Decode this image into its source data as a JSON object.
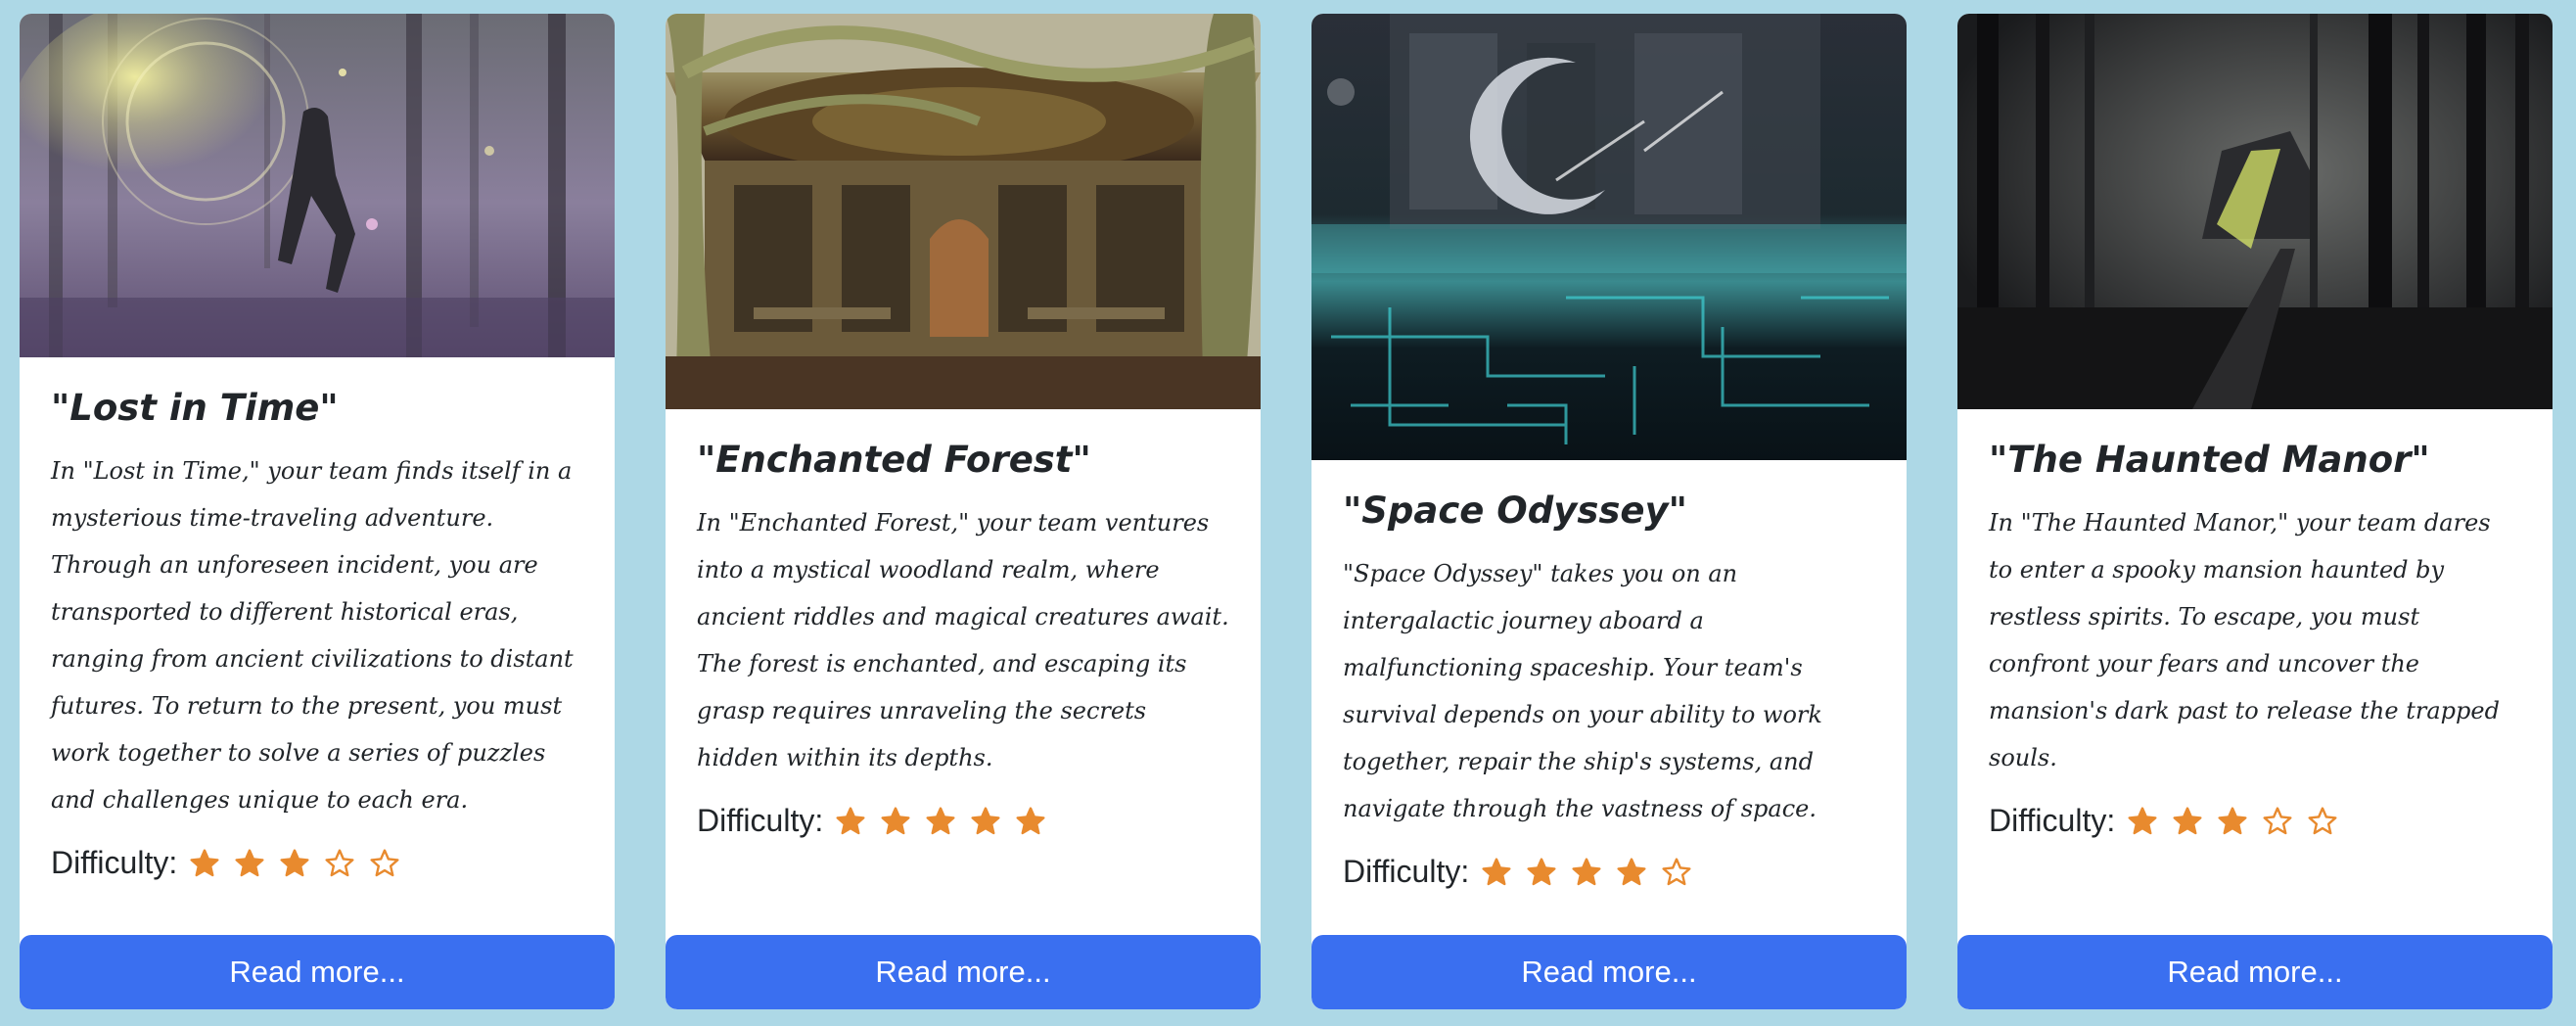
{
  "colors": {
    "background": "#add8e6",
    "card": "#ffffff",
    "button": "#3a6ff0",
    "star": "#e88a2e"
  },
  "cards": [
    {
      "title": "\"Lost in Time\"",
      "description": "In \"Lost in Time,\" your team finds itself in a mysterious time-traveling adventure. Through an unforeseen incident, you are transported to different historical eras, ranging from ancient civilizations to distant futures. To return to the present, you must work together to solve a series of puzzles and challenges unique to each era.",
      "difficulty_label": "Difficulty:",
      "difficulty_rating": 3,
      "difficulty_max": 5,
      "button_label": "Read more..."
    },
    {
      "title": "\"Enchanted Forest\"",
      "description": "In \"Enchanted Forest,\" your team ventures into a mystical woodland realm, where ancient riddles and magical creatures await. The forest is enchanted, and escaping its grasp requires unraveling the secrets hidden within its depths.",
      "difficulty_label": "Difficulty:",
      "difficulty_rating": 5,
      "difficulty_max": 5,
      "button_label": "Read more..."
    },
    {
      "title": "\"Space Odyssey\"",
      "description": "\"Space Odyssey\" takes you on an intergalactic journey aboard a malfunctioning spaceship. Your team's survival depends on your ability to work together, repair the ship's systems, and navigate through the vastness of space.",
      "difficulty_label": "Difficulty:",
      "difficulty_rating": 4,
      "difficulty_max": 5,
      "button_label": "Read more..."
    },
    {
      "title": "\"The Haunted Manor\"",
      "description": "In \"The Haunted Manor,\" your team dares to enter a spooky mansion haunted by restless spirits. To escape, you must confront your fears and uncover the mansion's dark past to release the trapped souls.",
      "difficulty_label": "Difficulty:",
      "difficulty_rating": 3,
      "difficulty_max": 5,
      "button_label": "Read more..."
    }
  ]
}
